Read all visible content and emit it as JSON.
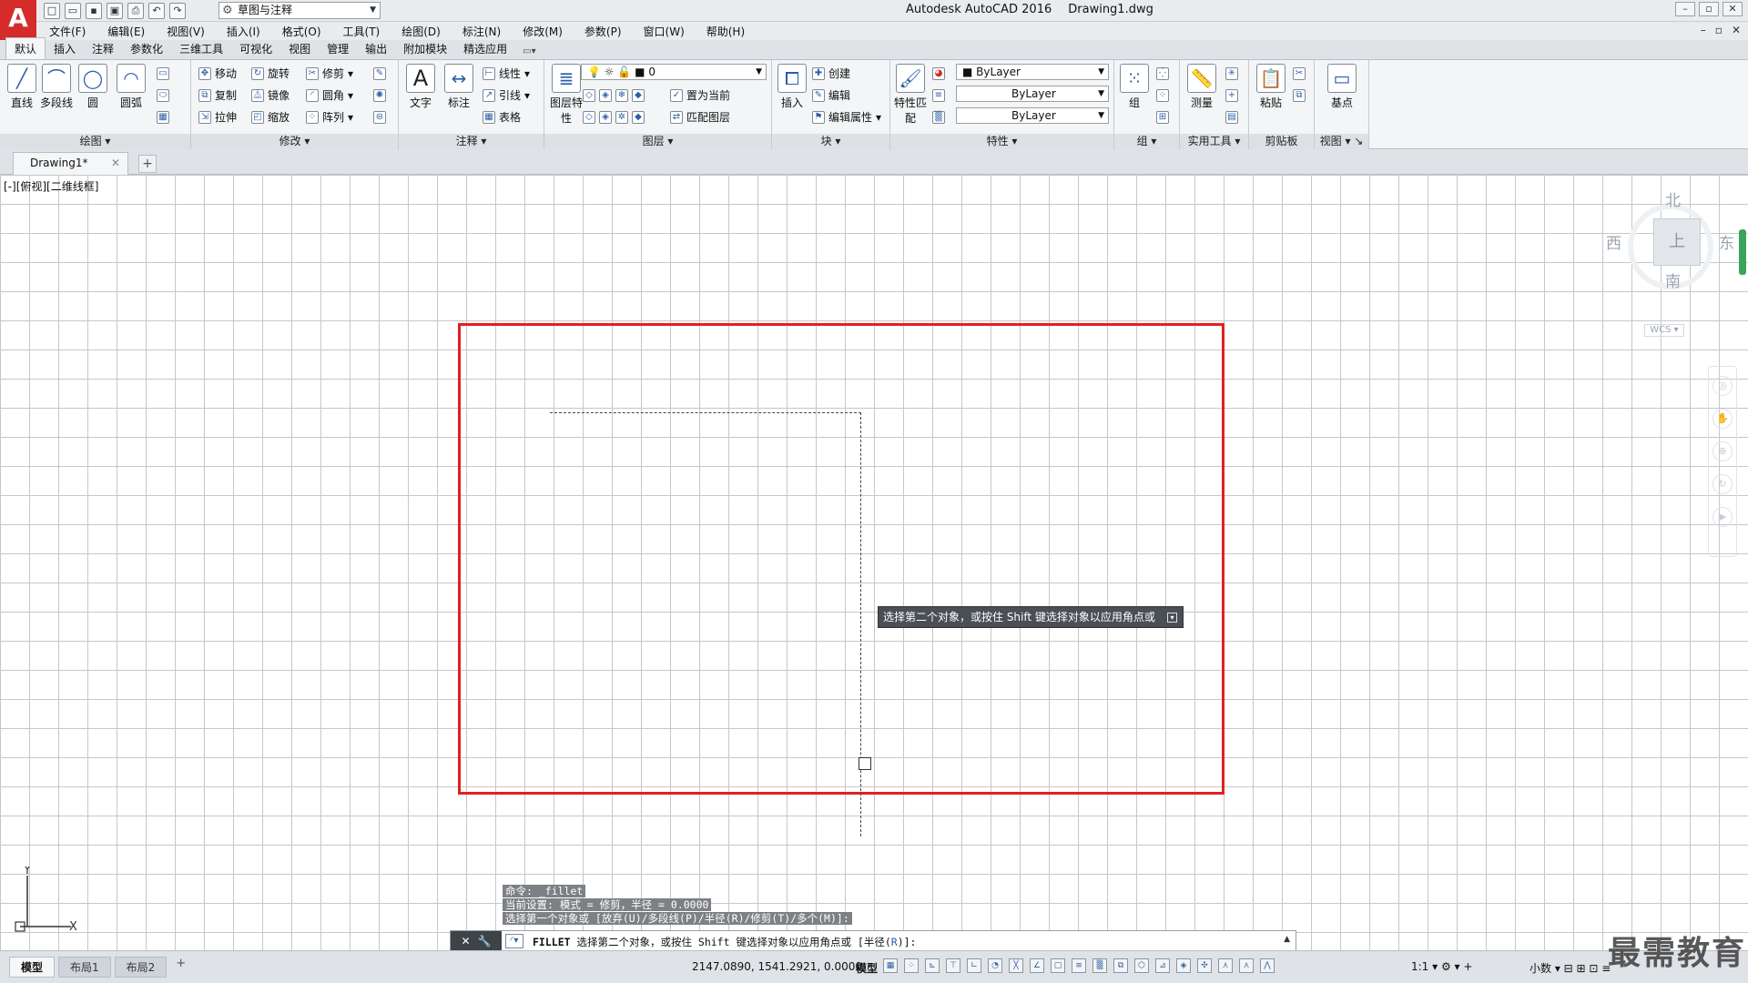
{
  "app": {
    "title": "Autodesk AutoCAD 2016",
    "file": "Drawing1.dwg",
    "logo": "A"
  },
  "quick_access": {
    "workspace": "草图与注释"
  },
  "menu": [
    "文件(F)",
    "编辑(E)",
    "视图(V)",
    "插入(I)",
    "格式(O)",
    "工具(T)",
    "绘图(D)",
    "标注(N)",
    "修改(M)",
    "参数(P)",
    "窗口(W)",
    "帮助(H)"
  ],
  "ribbon_tabs": [
    "默认",
    "插入",
    "注释",
    "参数化",
    "三维工具",
    "可视化",
    "视图",
    "管理",
    "输出",
    "附加模块",
    "精选应用"
  ],
  "ribbon": {
    "draw": {
      "title": "绘图",
      "line": "直线",
      "polyline": "多段线",
      "circle": "圆",
      "arc": "圆弧"
    },
    "modify": {
      "title": "修改",
      "move": "移动",
      "rotate": "旋转",
      "trim": "修剪",
      "copy": "复制",
      "mirror": "镜像",
      "fillet": "圆角",
      "stretch": "拉伸",
      "scale": "缩放",
      "array": "阵列"
    },
    "annotation": {
      "title": "注释",
      "text": "文字",
      "dimension": "标注",
      "linear": "线性",
      "leader": "引线",
      "table": "表格"
    },
    "layers": {
      "title": "图层",
      "layer_props": "图层特性",
      "current_layer": "0",
      "set_current": "置为当前",
      "match_layer": "匹配图层"
    },
    "block": {
      "title": "块",
      "insert": "插入",
      "create": "创建",
      "edit": "编辑",
      "edit_attr": "编辑属性"
    },
    "properties": {
      "title": "特性",
      "match": "特性匹配",
      "color": "ByLayer",
      "linetype": "ByLayer",
      "lineweight": "ByLayer"
    },
    "groups": {
      "title": "组",
      "group": "组"
    },
    "utilities": {
      "title": "实用工具",
      "measure": "测量"
    },
    "clipboard": {
      "title": "剪贴板",
      "paste": "粘贴"
    },
    "view": {
      "title": "视图",
      "base": "基点"
    }
  },
  "doc_tab": "Drawing1*",
  "viewport_label": "[-][俯视][二维线框]",
  "tooltip": "选择第二个对象，或按住 Shift 键选择对象以应用角点或",
  "viewcube": {
    "north": "北",
    "south": "南",
    "west": "西",
    "east": "东",
    "face": "上",
    "wcs": "WCS"
  },
  "ucs": {
    "y": "Y",
    "x": "X"
  },
  "command_history": [
    "命令: _fillet",
    "当前设置: 模式 = 修剪，半径 = 0.0000",
    "选择第一个对象或 [放弃(U)/多段线(P)/半径(R)/修剪(T)/多个(M)]:"
  ],
  "command_line": {
    "command": "FILLET",
    "prompt": "选择第二个对象，或按住 Shift 键选择对象以应用角点或",
    "option_open": "[半径(",
    "option_key": "R",
    "option_close": ")]:"
  },
  "status": {
    "layout_tabs": [
      "模型",
      "布局1",
      "布局2"
    ],
    "coords": "2147.0890, 1541.2921, 0.0000",
    "model": "模型",
    "scale": "1:1",
    "units": "小数"
  },
  "watermark": "最需教育",
  "colors": {
    "accent_red": "#e02020",
    "ribbon_bg": "#f3f5f7",
    "tooltip_bg": "#4a4f55"
  }
}
